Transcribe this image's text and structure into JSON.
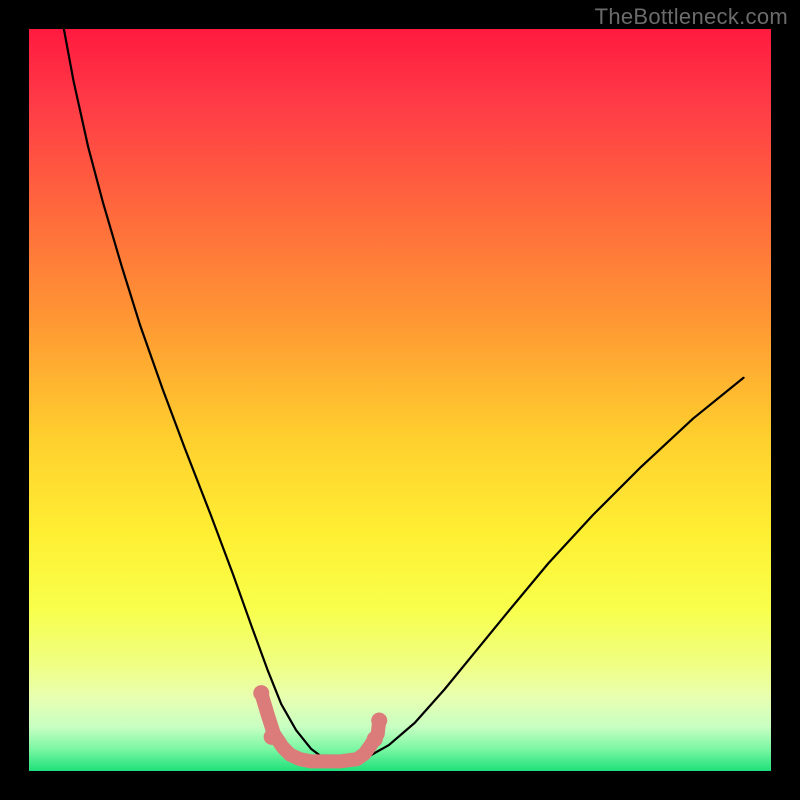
{
  "watermark": "TheBottleneck.com",
  "chart_data": {
    "type": "line",
    "title": "",
    "xlabel": "",
    "ylabel": "",
    "xlim": [
      0,
      100
    ],
    "ylim": [
      0,
      100
    ],
    "note": "Axis values are relative percentages estimated from pixel positions; no numeric tick labels are shown in the image.",
    "background_gradient": {
      "stops": [
        {
          "offset": 0.0,
          "color": "#ff1a3f"
        },
        {
          "offset": 0.1,
          "color": "#ff3b47"
        },
        {
          "offset": 0.25,
          "color": "#ff6a3c"
        },
        {
          "offset": 0.4,
          "color": "#ff9a33"
        },
        {
          "offset": 0.55,
          "color": "#ffcf2e"
        },
        {
          "offset": 0.68,
          "color": "#ffef33"
        },
        {
          "offset": 0.78,
          "color": "#f8ff4a"
        },
        {
          "offset": 0.86,
          "color": "#efff86"
        },
        {
          "offset": 0.9,
          "color": "#e8ffb0"
        },
        {
          "offset": 0.94,
          "color": "#c9ffc2"
        },
        {
          "offset": 0.97,
          "color": "#7cf7a3"
        },
        {
          "offset": 1.0,
          "color": "#1fe07a"
        }
      ]
    },
    "series": [
      {
        "name": "bottleneck-curve",
        "stroke": "#000000",
        "stroke_width": 2.2,
        "x": [
          4.7,
          6.0,
          8.0,
          10.0,
          12.5,
          15.0,
          18.0,
          21.0,
          24.5,
          27.5,
          30.0,
          32.2,
          34.0,
          36.0,
          38.0,
          40.0,
          42.5,
          45.5,
          48.5,
          52.0,
          56.0,
          60.5,
          65.0,
          70.0,
          76.0,
          82.5,
          89.5,
          96.3
        ],
        "y": [
          100.0,
          93.0,
          84.0,
          76.5,
          68.0,
          60.0,
          51.5,
          43.5,
          34.5,
          26.5,
          19.5,
          13.5,
          9.0,
          5.5,
          3.0,
          1.5,
          1.3,
          1.8,
          3.5,
          6.5,
          11.0,
          16.5,
          22.0,
          28.0,
          34.5,
          41.0,
          47.5,
          53.0
        ]
      },
      {
        "name": "optimal-zone-overlay",
        "stroke": "#db7b7a",
        "stroke_width": 14,
        "x": [
          31.3,
          32.2,
          33.0,
          34.2,
          35.2,
          36.5,
          38.0,
          40.0,
          42.0,
          44.2,
          45.2,
          46.0,
          47.0,
          47.2
        ],
        "y": [
          10.5,
          7.5,
          5.0,
          3.2,
          2.2,
          1.6,
          1.3,
          1.3,
          1.3,
          1.6,
          2.3,
          3.4,
          5.0,
          6.8
        ]
      }
    ],
    "overlay_dots": {
      "color": "#db7b7a",
      "radius_px": 8,
      "points_xy": [
        [
          31.3,
          10.5
        ],
        [
          32.7,
          4.6
        ],
        [
          46.6,
          4.3
        ],
        [
          47.2,
          6.8
        ]
      ]
    }
  }
}
